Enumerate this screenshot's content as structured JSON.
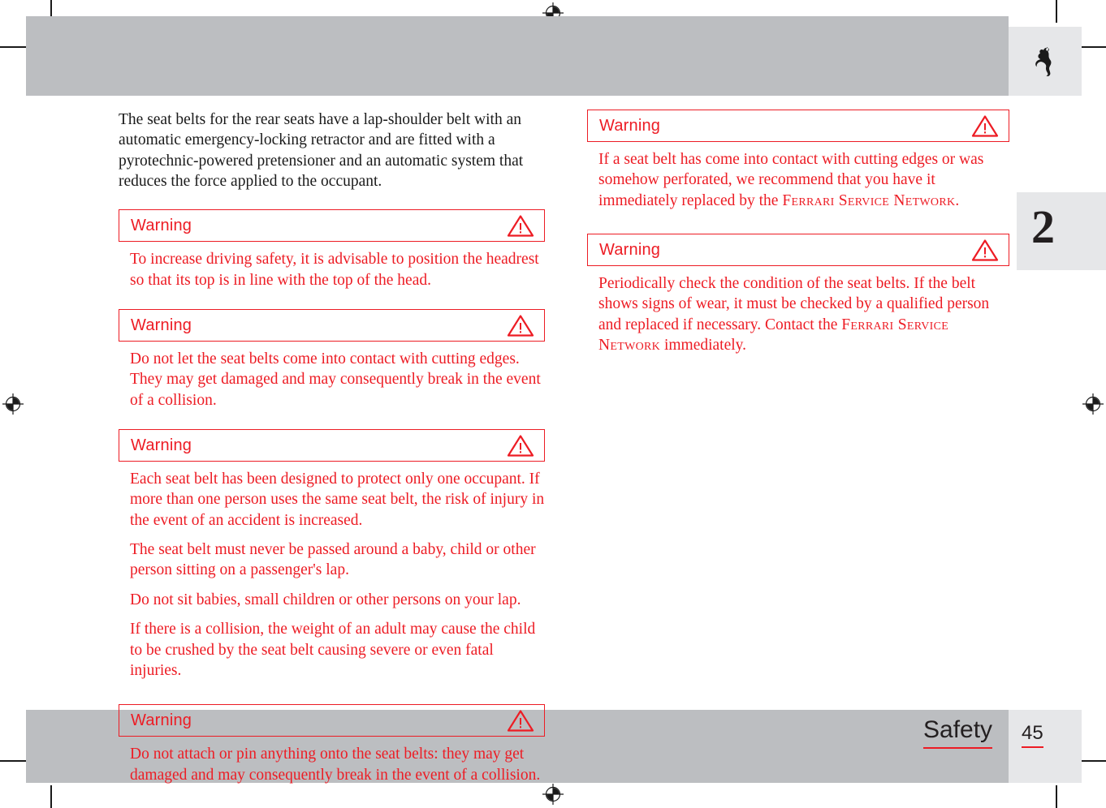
{
  "page": {
    "chapter_number": "2",
    "page_number": "45",
    "section_title": "Safety",
    "logo_icon": "ferrari-prancing-horse-logo",
    "accent_color": "#ed1c24",
    "band_color": "#bcbec1",
    "tab_color": "#e6e7e9"
  },
  "left_column": {
    "intro": "The seat belts for the rear seats have a lap-shoulder belt with an automatic emergency-locking retractor and are fitted with a pyrotechnic-powered pretensioner and an automatic system that reduces the force applied to the occupant.",
    "warnings": [
      {
        "label": "Warning",
        "icon": "warning-triangle-icon",
        "paragraphs": [
          "To increase driving safety, it is advisable to position the headrest so that its top is in line with the top of the head."
        ]
      },
      {
        "label": "Warning",
        "icon": "warning-triangle-icon",
        "paragraphs": [
          "Do not let the seat belts come into contact with cutting edges. They may get damaged and may consequently break in the event of a collision."
        ]
      },
      {
        "label": "Warning",
        "icon": "warning-triangle-icon",
        "paragraphs": [
          "Each seat belt has been designed to protect only one occupant. If more than one person uses the same seat belt, the risk of injury in the event of an accident is increased.",
          "The seat belt must never be passed around a baby, child or other person sitting on a passenger's lap.",
          "Do not sit babies, small children or other persons on your lap.",
          "If there is a collision, the weight of an adult may cause the child to be crushed by the seat belt causing severe or even fatal injuries."
        ]
      },
      {
        "label": "Warning",
        "icon": "warning-triangle-icon",
        "paragraphs": [
          "Do not attach or pin anything onto the seat belts: they may get damaged and may consequently break in the event of a collision."
        ]
      }
    ]
  },
  "right_column": {
    "warnings": [
      {
        "label": "Warning",
        "icon": "warning-triangle-icon",
        "paragraphs": [
          "If a seat belt has come into contact with cutting edges or was somehow perforated, we recommend that you have it immediately replaced by the Ferrari Service Network."
        ],
        "small_caps_terms": [
          "Ferrari Service Network"
        ]
      },
      {
        "label": "Warning",
        "icon": "warning-triangle-icon",
        "paragraphs": [
          "Periodically check the condition of the seat belts. If the belt shows signs of wear, it must be checked by a qualified person and replaced if necessary. Contact the Ferrari Service Network immediately."
        ],
        "small_caps_terms": [
          "Ferrari Service Network"
        ]
      }
    ]
  }
}
